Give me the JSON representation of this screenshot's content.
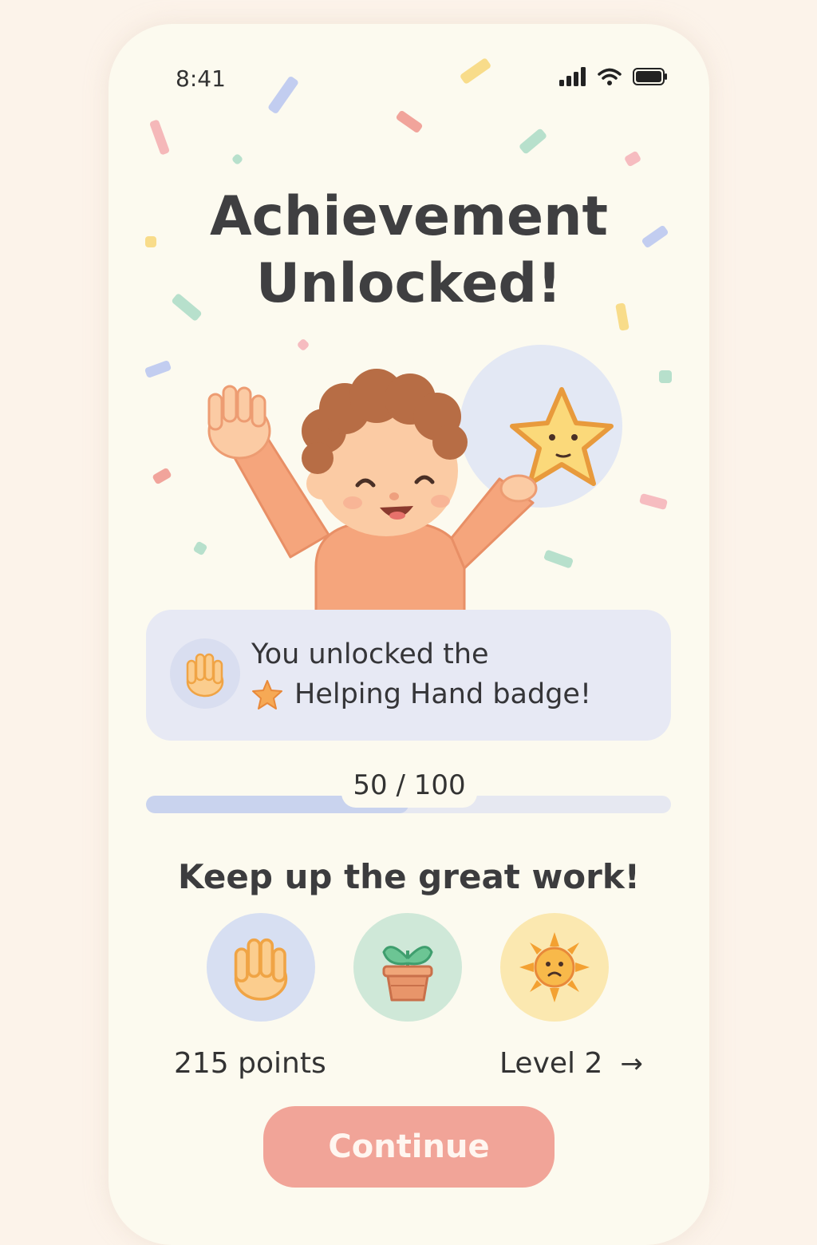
{
  "status_bar": {
    "time": "8:41",
    "icons": [
      "signal-icon",
      "wifi-icon",
      "battery-icon"
    ]
  },
  "title": {
    "line1": "Achievement",
    "line2": "Unlocked!"
  },
  "illustration": {
    "subject": "child-celebrating-with-star"
  },
  "badge_card": {
    "line1": "You unlocked the",
    "line2": "Helping Hand badge!",
    "icon": "hand-icon",
    "accent_icon": "star-icon"
  },
  "progress": {
    "label": "50 / 100",
    "current": 50,
    "max": 100
  },
  "encouragement": "Keep up the great work!",
  "badges": [
    {
      "icon": "hand-icon",
      "bg": "#d7dff2"
    },
    {
      "icon": "plant-icon",
      "bg": "#cfe8d8"
    },
    {
      "icon": "sun-icon",
      "bg": "#fbe8b0"
    }
  ],
  "stats": {
    "points": "215 points",
    "level": "Level 2",
    "level_arrow": "→"
  },
  "continue_button": "Continue",
  "colors": {
    "background": "#fcf3ea",
    "card": "#fcfaef",
    "accent": "#f1a498",
    "progress_fill": "#c9d3ee"
  }
}
